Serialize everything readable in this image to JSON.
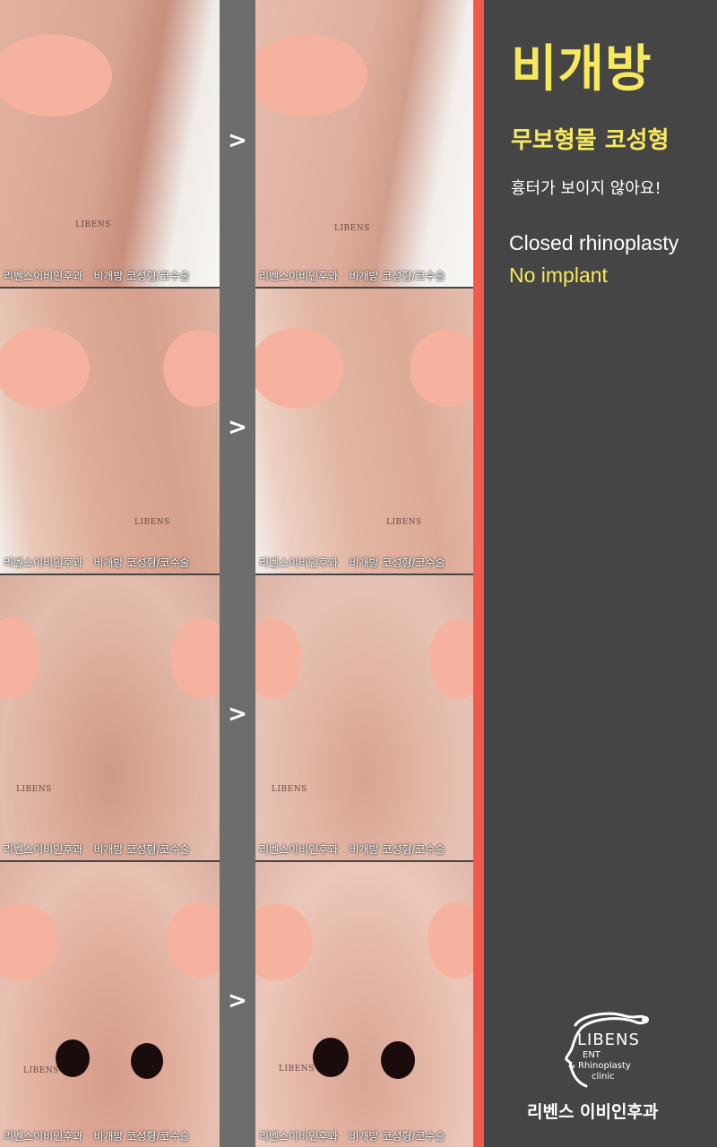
{
  "panel": {
    "title": "비개방",
    "subtitle": "무보형물 코성형",
    "note": "흉터가 보이지 않아요!",
    "english_line1": "Closed rhinoplasty",
    "english_line2": "No implant",
    "accent_color": "#f7e95d",
    "divider_color": "#ef5a4c",
    "background_color": "#454545"
  },
  "logo": {
    "name": "LIBENS",
    "line2": "ENT",
    "line3": "& Rhinoplasty",
    "line4": "clinic",
    "korean_name": "리벤스 이비인후과",
    "icon": "head-profile-logo-icon"
  },
  "comparison": {
    "arrow_symbol": ">",
    "watermark": "LIBENS",
    "caption_clinic": "리벤스이비인후과",
    "caption_procedure": "비개방 코성형/코수술"
  }
}
